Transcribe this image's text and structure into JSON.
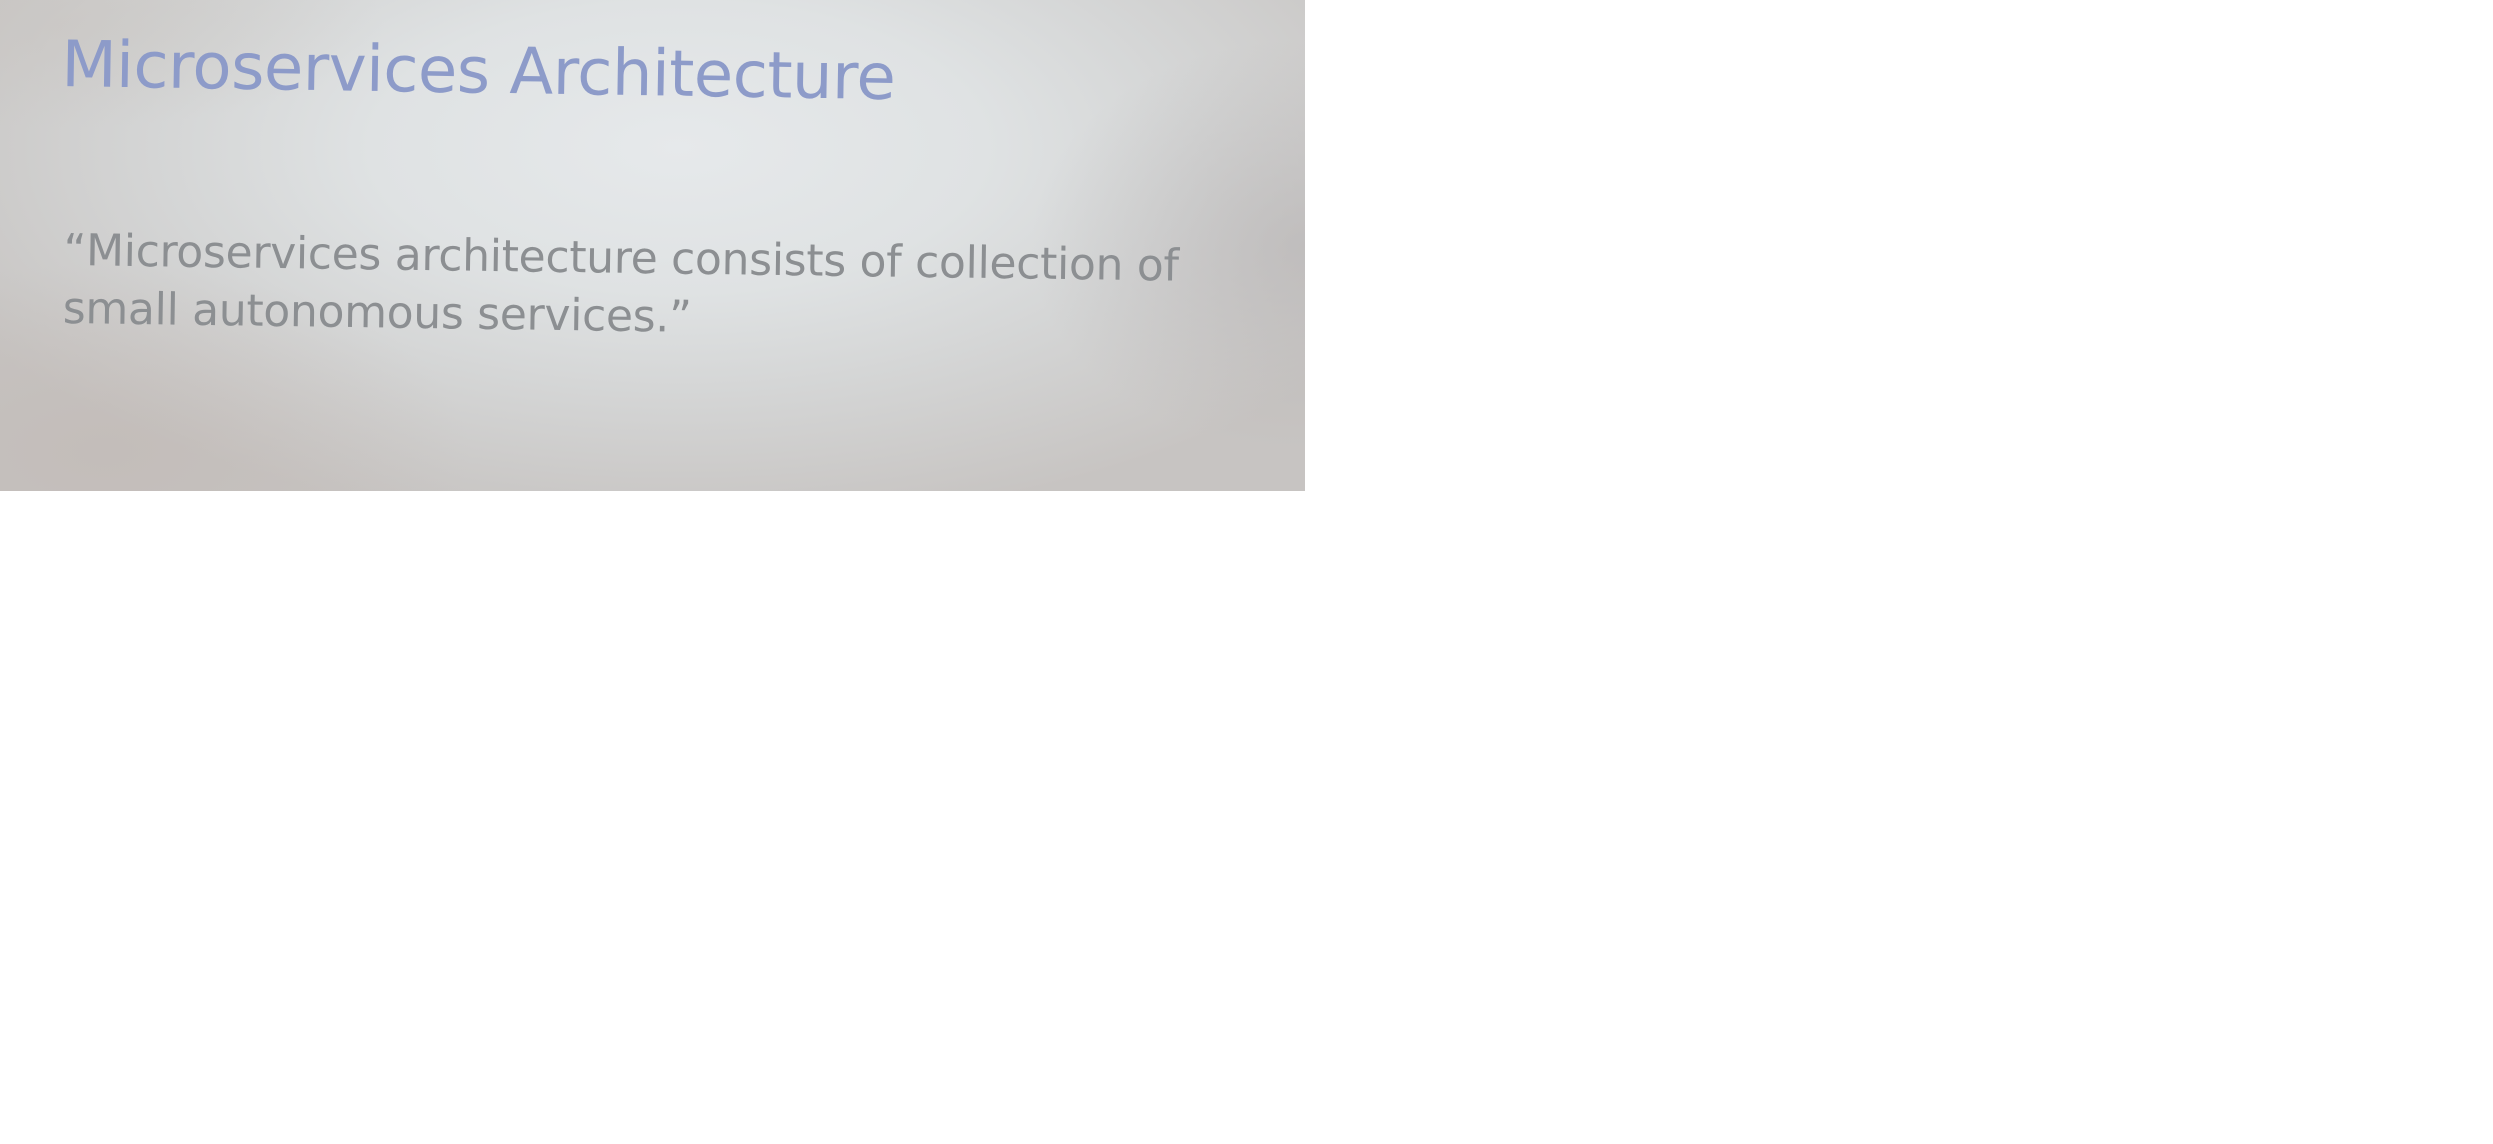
{
  "slide": {
    "title": "Microservices Architecture",
    "quote_lines": [
      "“Microservices architecture consists of collection of",
      "small autonomous services.”"
    ]
  },
  "colors": {
    "title": "#8d9bc9",
    "body_text": "#8c8f92",
    "slide_background": "#dfe2e3",
    "page_background": "#ffffff"
  }
}
